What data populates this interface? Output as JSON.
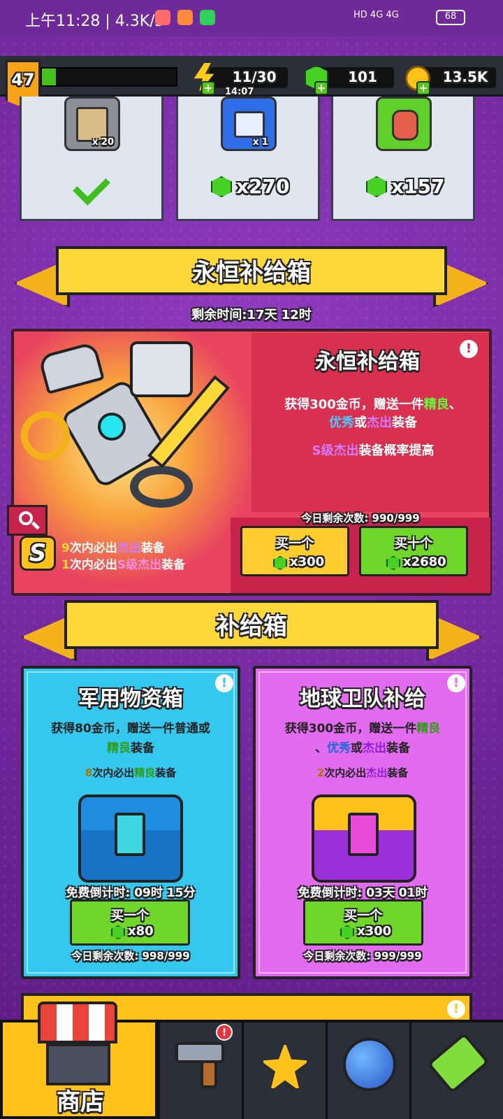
{
  "status_bar": {
    "time": "上午11:28 | 4.3K/s",
    "battery": "68",
    "network": "HD 4G 4G"
  },
  "resources": {
    "level": "47",
    "energy": "11/30",
    "energy_timer": "14:07",
    "gems": "101",
    "coins": "13.5K"
  },
  "top_cards": [
    {
      "count": "x 20",
      "price": "",
      "claimed": true
    },
    {
      "count": "x 1",
      "price": "x270"
    },
    {
      "count": "",
      "price": "x157"
    }
  ],
  "eternal_supply": {
    "banner_title": "永恒补给箱",
    "remaining_time": "剩余时间:17天 12时",
    "panel_title": "永恒补给箱",
    "desc_part1": "获得300金币，赠送一件",
    "desc_good": "精良",
    "desc_sep": "、",
    "desc_excellent": "优秀",
    "desc_or": "或",
    "desc_outstanding": "杰出",
    "desc_part2": "装备",
    "s_rate_s": "S级杰出",
    "s_rate_rest": "装备概率提高",
    "today_remaining": "今日剩余次数: 990/999",
    "guarantee1_num": "9",
    "guarantee1_mid": "次内必出",
    "guarantee1_tier": "杰出",
    "guarantee1_end": "装备",
    "guarantee2_num": "1",
    "guarantee2_mid": "次内必出",
    "guarantee2_tier": "S级杰出",
    "guarantee2_end": "装备",
    "buy_one_label": "买一个",
    "buy_one_price": "x300",
    "buy_ten_label": "买十个",
    "buy_ten_price": "x2680",
    "s_badge": "S"
  },
  "supply_section": {
    "banner_title": "补给箱"
  },
  "military_box": {
    "title": "军用物资箱",
    "desc_line1": "获得80金币，赠送一件普通或",
    "desc_good": "精良",
    "desc_end": "装备",
    "guarantee_num": "8",
    "guarantee_mid": "次内必出",
    "guarantee_tier": "精良",
    "guarantee_end": "装备",
    "timer": "免费倒计时: 09时 15分",
    "buy_label": "买一个",
    "price": "x80",
    "remaining": "今日剩余次数: 998/999",
    "color_bg": "#35c8ee"
  },
  "earth_guard_box": {
    "title": "地球卫队补给",
    "desc_line1": "获得300金币，赠送一件",
    "desc_good": "精良",
    "desc_sep": "、",
    "desc_excellent": "优秀",
    "desc_or": "或",
    "desc_outstanding": "杰出",
    "desc_end": "装备",
    "guarantee_num": "2",
    "guarantee_mid": "次内必出",
    "guarantee_tier": "杰出",
    "guarantee_end": "装备",
    "timer": "免费倒计时: 03天 01时",
    "buy_label": "买一个",
    "price": "x300",
    "remaining": "今日剩余次数: 999/999",
    "color_bg": "#e36bf0"
  },
  "bottom_nav": {
    "shop_label": "商店",
    "items": [
      "shop",
      "weapons",
      "missions",
      "planet",
      "lab"
    ]
  }
}
